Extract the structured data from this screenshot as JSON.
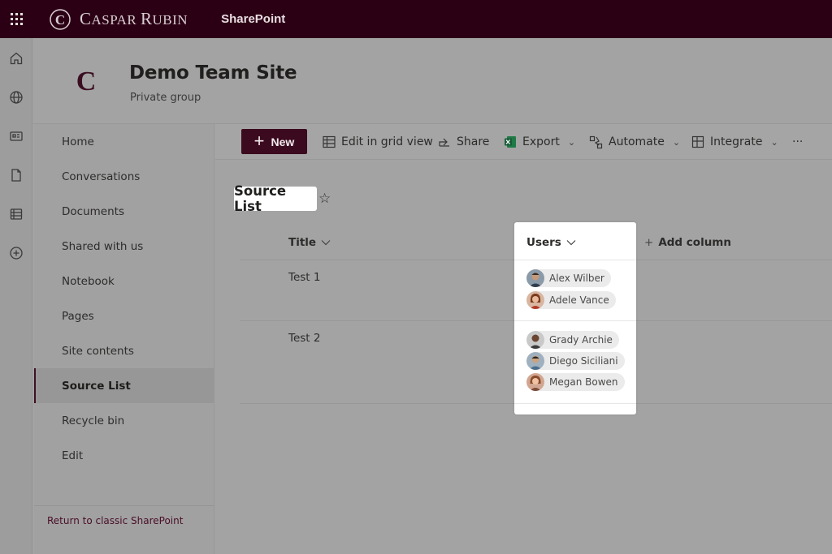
{
  "suitebar": {
    "brand_initial": "C",
    "brand_caps_1": "C",
    "brand_small_1": "ASPAR ",
    "brand_caps_2": "R",
    "brand_small_2": "UBIN",
    "app_name": "SharePoint",
    "background": "#2c0014"
  },
  "appbar": {
    "icons": [
      "home-icon",
      "globe-icon",
      "news-icon",
      "file-icon",
      "lists-icon",
      "create-icon"
    ]
  },
  "site": {
    "title": "Demo Team Site",
    "subtitle": "Private group"
  },
  "nav": {
    "items": [
      {
        "label": "Home"
      },
      {
        "label": "Conversations"
      },
      {
        "label": "Documents"
      },
      {
        "label": "Shared with us"
      },
      {
        "label": "Notebook"
      },
      {
        "label": "Pages"
      },
      {
        "label": "Site contents"
      },
      {
        "label": "Source List",
        "selected": true
      },
      {
        "label": "Recycle bin"
      },
      {
        "label": "Edit"
      }
    ],
    "footer_link": "Return to classic SharePoint"
  },
  "commandbar": {
    "new_label": "New",
    "grid_label": "Edit in grid view",
    "share_label": "Share",
    "export_label": "Export",
    "automate_label": "Automate",
    "integrate_label": "Integrate",
    "more_label": "···"
  },
  "list": {
    "title": "Source List",
    "columns": {
      "title": "Title",
      "users": "Users",
      "add_column": "Add column"
    },
    "rows": [
      {
        "title": "Test 1",
        "users": [
          "Alex Wilber",
          "Adele Vance"
        ]
      },
      {
        "title": "Test 2",
        "users": [
          "Grady Archie",
          "Diego Siciliani",
          "Megan Bowen"
        ]
      }
    ]
  },
  "colors": {
    "accent": "#3b0a1e",
    "link": "#4a0f28"
  }
}
